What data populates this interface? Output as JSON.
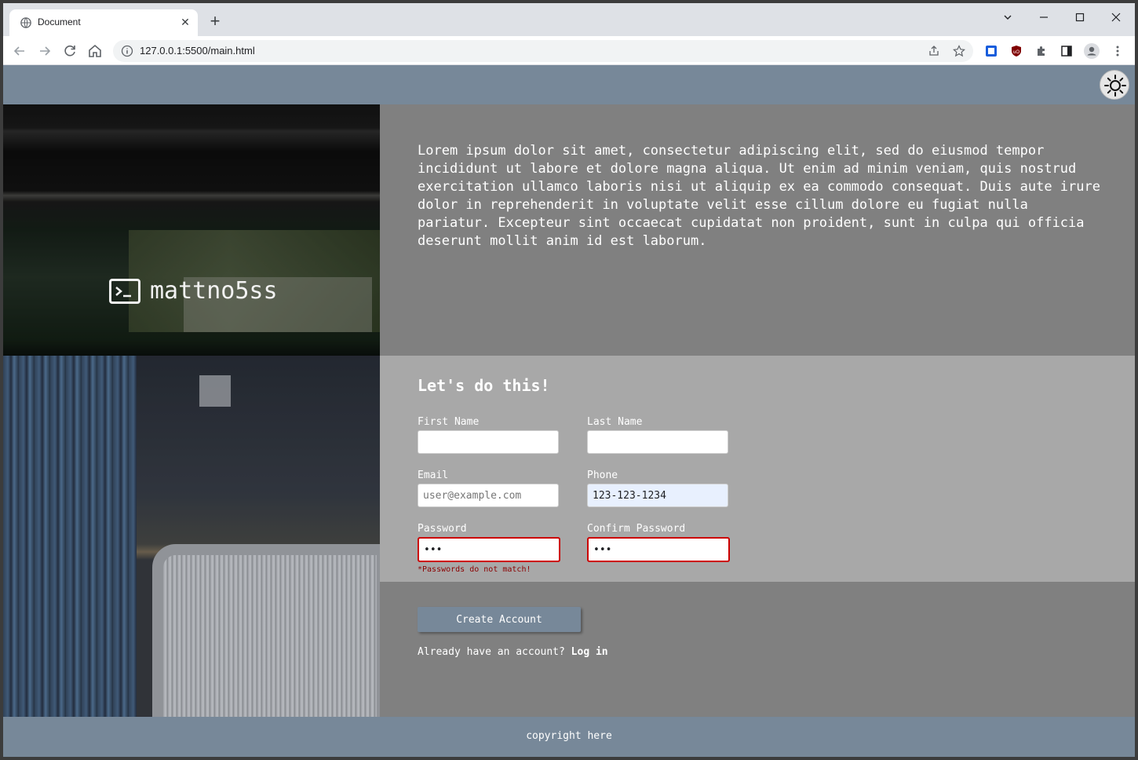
{
  "browser": {
    "tab_title": "Document",
    "url": "127.0.0.1:5500/main.html",
    "new_tab_symbol": "+",
    "tab_close_symbol": "✕"
  },
  "site": {
    "brand_name": "mattno5ss",
    "intro_text": "Lorem ipsum dolor sit amet, consectetur adipiscing elit, sed do eiusmod tempor incididunt ut labore et dolore magna aliqua. Ut enim ad minim veniam, quis nostrud exercitation ullamco laboris nisi ut aliquip ex ea commodo consequat. Duis aute irure dolor in reprehenderit in voluptate velit esse cillum dolore eu fugiat nulla pariatur. Excepteur sint occaecat cupidatat non proident, sunt in culpa qui officia deserunt mollit anim id est laborum.",
    "footer_text": "copyright here"
  },
  "form": {
    "title": "Let's do this!",
    "first_name": {
      "label": "First Name",
      "value": "",
      "placeholder": ""
    },
    "last_name": {
      "label": "Last Name",
      "value": "",
      "placeholder": ""
    },
    "email": {
      "label": "Email",
      "value": "",
      "placeholder": "user@example.com"
    },
    "phone": {
      "label": "Phone",
      "value": "123-123-1234",
      "placeholder": ""
    },
    "password": {
      "label": "Password",
      "value": "abc"
    },
    "confirm_password": {
      "label": "Confirm Password",
      "value": "abd"
    },
    "error_message": "*Passwords do not match!",
    "submit_label": "Create Account",
    "login_prompt": "Already have an account?",
    "login_link": "Log in"
  },
  "colors": {
    "header": "#778899",
    "panel": "#808080",
    "form_panel": "#a8a8a8",
    "error": "#cc0000"
  }
}
